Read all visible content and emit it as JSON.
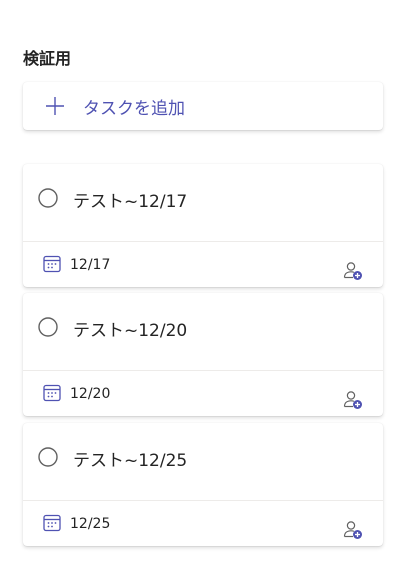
{
  "bucket": {
    "title": "検証用"
  },
  "add_task": {
    "label": "タスクを追加"
  },
  "tasks": [
    {
      "title": "テスト~12/17",
      "due": "12/17"
    },
    {
      "title": "テスト~12/20",
      "due": "12/20"
    },
    {
      "title": "テスト~12/25",
      "due": "12/25"
    }
  ],
  "colors": {
    "accent": "#4f52b2",
    "text": "#242424",
    "divider": "#edebe9"
  },
  "icons": {
    "add": "plus-icon",
    "complete": "circle-check-icon",
    "due": "calendar-icon",
    "assign": "add-person-icon"
  }
}
